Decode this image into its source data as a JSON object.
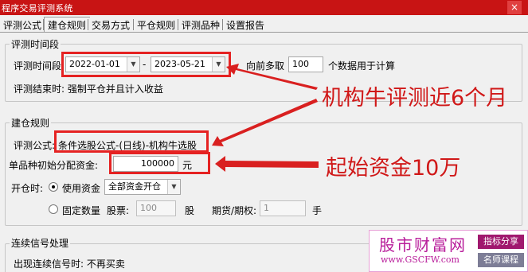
{
  "window": {
    "title": "程序交易评测系统",
    "close_glyph": "×"
  },
  "tabs": [
    {
      "label": "评测公式"
    },
    {
      "label": "建仓规则",
      "active": true
    },
    {
      "label": "交易方式"
    },
    {
      "label": "平仓规则"
    },
    {
      "label": "评测品种"
    },
    {
      "label": "设置报告"
    }
  ],
  "period": {
    "group_title": "评测时间段",
    "label": "评测时间段:",
    "start_date": "2022-01-01",
    "separator": "-",
    "end_date": "2023-05-21",
    "lookback_label": "向前多取",
    "lookback_value": "100",
    "lookback_suffix": "个数据用于计算",
    "end_label": "评测结束时: 强制平仓并且计入收益"
  },
  "build": {
    "group_title": "建仓规则",
    "formula_label": "评测公式:",
    "formula_value": "条件选股公式-(日线)-机构牛选股",
    "capital_label": "单品种初始分配资金:",
    "capital_value": "100000",
    "capital_unit": "元",
    "open_label": "开仓时:",
    "opt_use_funds": "使用资金",
    "funds_select": "全部资金开仓",
    "opt_fixed_qty": "固定数量",
    "stock_label": "股票:",
    "stock_value": "100",
    "stock_unit": "股",
    "futures_label": "期货/期权:",
    "futures_value": "1",
    "futures_unit": "手",
    "selected_option": "use_funds"
  },
  "signal": {
    "group_title": "连续信号处理",
    "label": "出现连续信号时: 不再买卖"
  },
  "annotations": {
    "callout1": "机构牛评测近6个月",
    "callout2": "起始资金10万",
    "color": "#d01818"
  },
  "watermark": {
    "title": "股市财富网",
    "url": "www.GSCFW.com",
    "badge1": "指标分享",
    "badge2": "名师课程"
  }
}
